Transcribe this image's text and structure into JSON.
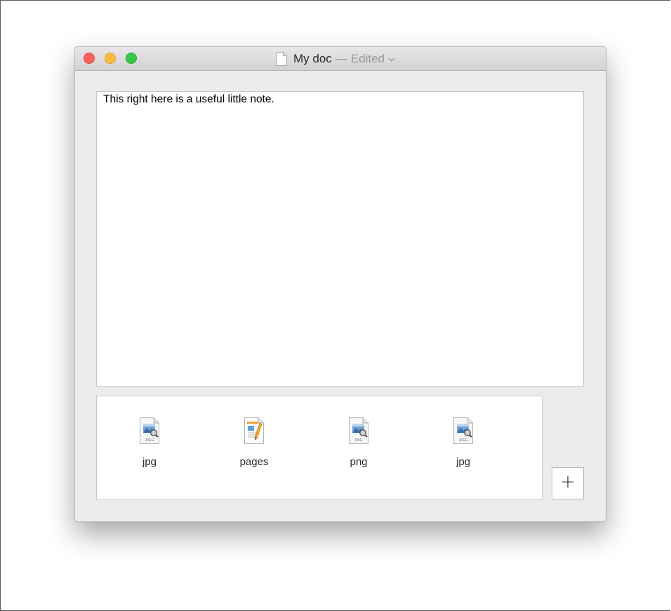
{
  "window": {
    "title": "My doc",
    "separator": "—",
    "state": "Edited"
  },
  "note": {
    "text": "This right here is a useful little note."
  },
  "attachments": [
    {
      "label": "jpg",
      "badge": "JPEG",
      "icon": "jpeg-file-icon"
    },
    {
      "label": "pages",
      "badge": "",
      "icon": "pages-file-icon"
    },
    {
      "label": "png",
      "badge": "PNG",
      "icon": "png-file-icon"
    },
    {
      "label": "jpg",
      "badge": "JPEG",
      "icon": "jpeg-file-icon"
    }
  ],
  "add_button": {
    "label": "+"
  },
  "colors": {
    "close": "#fc605c",
    "minimize": "#fdbc40",
    "zoom": "#34c84a",
    "window_bg": "#ececec"
  }
}
